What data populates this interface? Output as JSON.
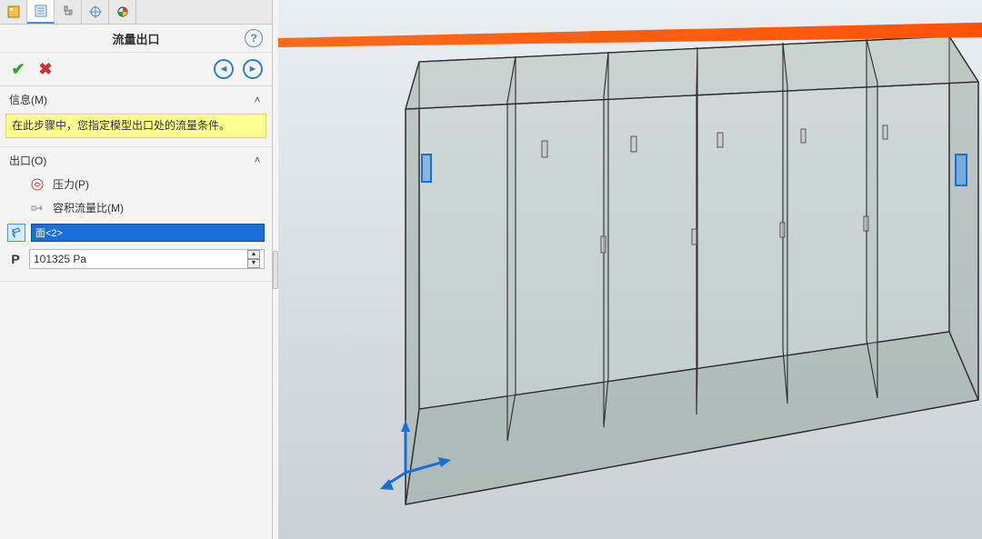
{
  "header": {
    "title": "流量出口"
  },
  "toolbar": {
    "ok_tip": "OK",
    "cancel_tip": "Cancel",
    "prev_tip": "Previous",
    "next_tip": "Next",
    "help_tip": "?"
  },
  "sections": {
    "info": {
      "label": "信息(M)",
      "text": "在此步骤中，您指定模型出口处的流量条件。"
    },
    "outlet": {
      "label": "出口(O)",
      "opt_pressure": "压力(P)",
      "opt_volume": "容积流量比(M)",
      "selection": "面<2>",
      "pressure_symbol": "P",
      "pressure_value": "101325 Pa"
    }
  },
  "tabs": {
    "t1": "feature-tree-icon",
    "t2": "property-manager-icon",
    "t3": "configuration-icon",
    "t4": "dim-target-icon",
    "t5": "appearance-icon"
  }
}
